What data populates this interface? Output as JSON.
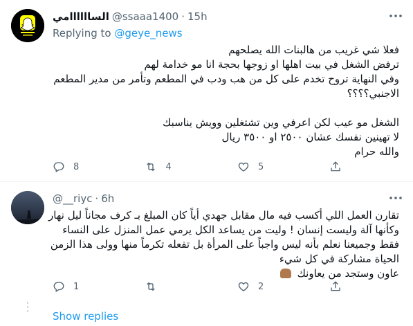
{
  "tweet1": {
    "display_name": "الساااااامي",
    "handle": "@ssaaa1400",
    "dot": "·",
    "time": "15h",
    "replying_prefix": "Replying to",
    "replying_to": "@geye_news",
    "lines": [
      "فعلا شي غريب من هالبنات الله يصلحهم",
      "ترفض الشغل في بيت اهلها او زوجها بحجة انا مو خدامة لهم",
      "وفي النهاية تروح تخدم على كل من هب ودب في المطعم وتأمر من مدير المطعم",
      "الاجنبي؟؟؟؟",
      "",
      "الشغل مو عيب لكن اعرفي وين تشتغلين وويش يناسبك",
      "لا تهينين نفسك عشان ٢٥٠٠ او ٣٥٠٠ ريال",
      "والله حرام"
    ],
    "reply_count": "8",
    "retweet_count": "4",
    "like_count": "5"
  },
  "tweet2": {
    "display_name": "__riyc",
    "handle": "@__riyc",
    "dot": "·",
    "time": "6h",
    "lines": [
      "تقارن العمل اللي أكسب فيه مال مقابل جهدي أياً كان المبلغ بـ كرف مجاناً ليل نهار",
      "وكأنها آلة وليست إنسان ! وليت من يساعد الكل يرمي عمل المنزل على النساء",
      "فقط وجميعنا نعلم بأنه ليس واجباً على المرأة بل تفعله تكرماً منها وولى هذا الزمن",
      "الحياة مشاركة في كل شيء",
      "عاون وستجد من يعاونك"
    ],
    "reply_count": "1",
    "retweet_count": "",
    "like_count": "2",
    "show_replies": "Show replies"
  },
  "icons": {
    "reply": "reply-icon",
    "retweet": "retweet-icon",
    "like": "heart-icon",
    "share": "share-icon",
    "more": "more-icon"
  },
  "colors": {
    "link": "#1d9bf0",
    "secondary_text": "#536471",
    "primary_text": "#0f1419",
    "divider": "#eff3f4"
  }
}
